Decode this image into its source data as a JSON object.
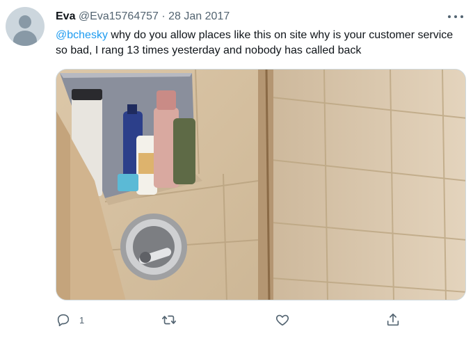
{
  "tweet": {
    "author_name": "Eva",
    "handle": "@Eva15764757",
    "separator": "·",
    "date": "28 Jan 2017",
    "mention": "@bchesky",
    "text": " why do you allow places like this on site why is your customer service so bad, I rang 13 times yesterday and nobody has called back"
  },
  "actions": {
    "reply_count": "1",
    "retweet_count": "",
    "like_count": ""
  },
  "icons": {
    "reply": "reply-icon",
    "retweet": "retweet-icon",
    "like": "heart-icon",
    "share": "share-icon",
    "more": "more-icon"
  },
  "colors": {
    "mention": "#1d9bf0",
    "secondary_text": "#536471"
  }
}
